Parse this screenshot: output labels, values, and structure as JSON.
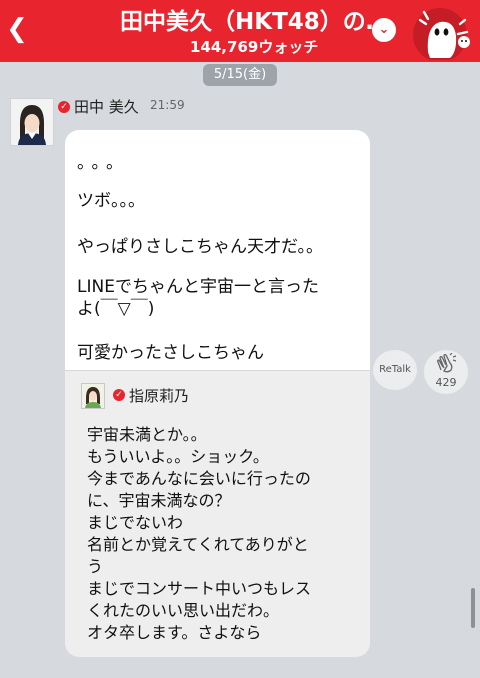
{
  "header": {
    "back_icon": "chevron-left-icon",
    "title": "田中美久（HKT48）の…",
    "watch_count": "144,769ウォッチ",
    "dropdown_icon": "chevron-down-icon",
    "mascot_icon": "talk-mascot-icon",
    "brand_color": "#e8252e"
  },
  "date_label": "5/15(金)",
  "post": {
    "author": "田中 美久",
    "time": "21:59",
    "lines": [
      "。。。",
      "ツボ。。。",
      "やっぱりさしこちゃん天才だ。。",
      "LINEでちゃんと宇宙一と言った",
      "よ(￣▽￣)",
      "可愛かったさしこちゃん"
    ],
    "quoted": {
      "author": "指原莉乃",
      "lines": [
        "宇宙未満とか。。",
        "もういいよ。。ショック。",
        "今まであんなに会いに行ったの",
        "に、宇宙未満なの？",
        "まじでないわ",
        "名前とか覚えてくれてありがと",
        "う",
        "まじでコンサート中いつもレス",
        "くれたのいい思い出だわ。",
        "オタ卒します。さよなら"
      ]
    }
  },
  "actions": {
    "retalk_label": "ReTalk",
    "clap_count": "429",
    "clap_icon": "clapping-hands-icon"
  }
}
